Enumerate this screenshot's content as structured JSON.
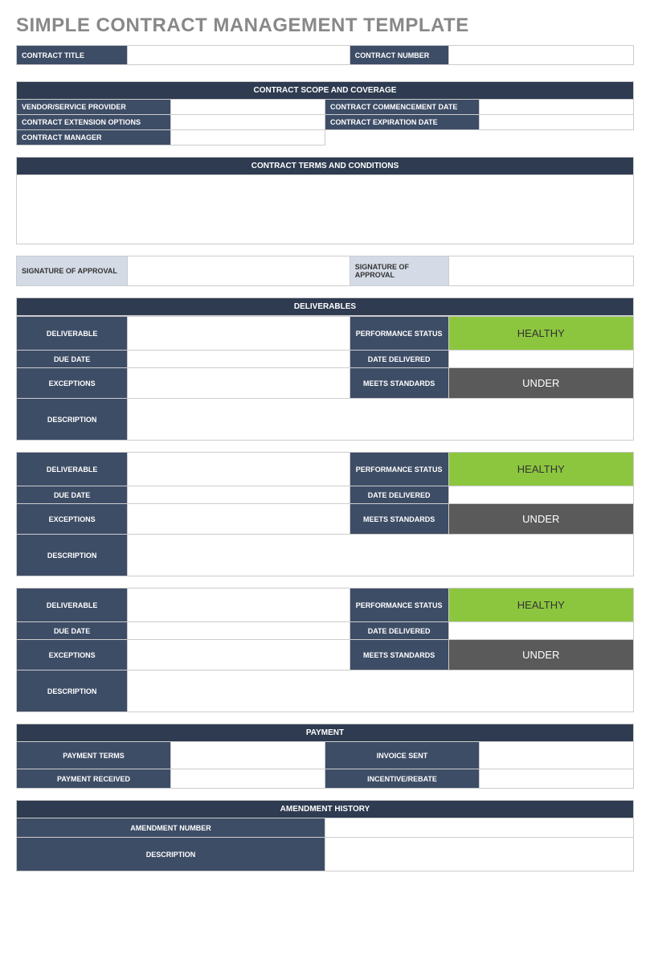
{
  "title": "SIMPLE CONTRACT MANAGEMENT TEMPLATE",
  "top": {
    "contract_title": "CONTRACT TITLE",
    "contract_number": "CONTRACT NUMBER"
  },
  "scope": {
    "header": "CONTRACT SCOPE AND COVERAGE",
    "vendor": "VENDOR/SERVICE PROVIDER",
    "commencement": "CONTRACT COMMENCEMENT DATE",
    "extension": "CONTRACT EXTENSION OPTIONS",
    "expiration": "CONTRACT EXPIRATION DATE",
    "manager": "CONTRACT MANAGER"
  },
  "terms": {
    "header": "CONTRACT TERMS AND CONDITIONS"
  },
  "signature": {
    "left": "SIGNATURE OF APPROVAL",
    "right": "SIGNATURE OF APPROVAL"
  },
  "deliverables": {
    "header": "DELIVERABLES",
    "labels": {
      "deliverable": "DELIVERABLE",
      "performance": "PERFORMANCE STATUS",
      "due": "DUE DATE",
      "delivered": "DATE DELIVERED",
      "exceptions": "EXCEPTIONS",
      "standards": "MEETS STANDARDS",
      "description": "DESCRIPTION"
    },
    "items": [
      {
        "performance": "HEALTHY",
        "standards": "UNDER"
      },
      {
        "performance": "HEALTHY",
        "standards": "UNDER"
      },
      {
        "performance": "HEALTHY",
        "standards": "UNDER"
      }
    ]
  },
  "payment": {
    "header": "PAYMENT",
    "terms": "PAYMENT TERMS",
    "invoice": "INVOICE SENT",
    "received": "PAYMENT RECEIVED",
    "incentive": "INCENTIVE/REBATE"
  },
  "amendment": {
    "header": "AMENDMENT HISTORY",
    "number": "AMENDMENT NUMBER",
    "description": "DESCRIPTION"
  }
}
